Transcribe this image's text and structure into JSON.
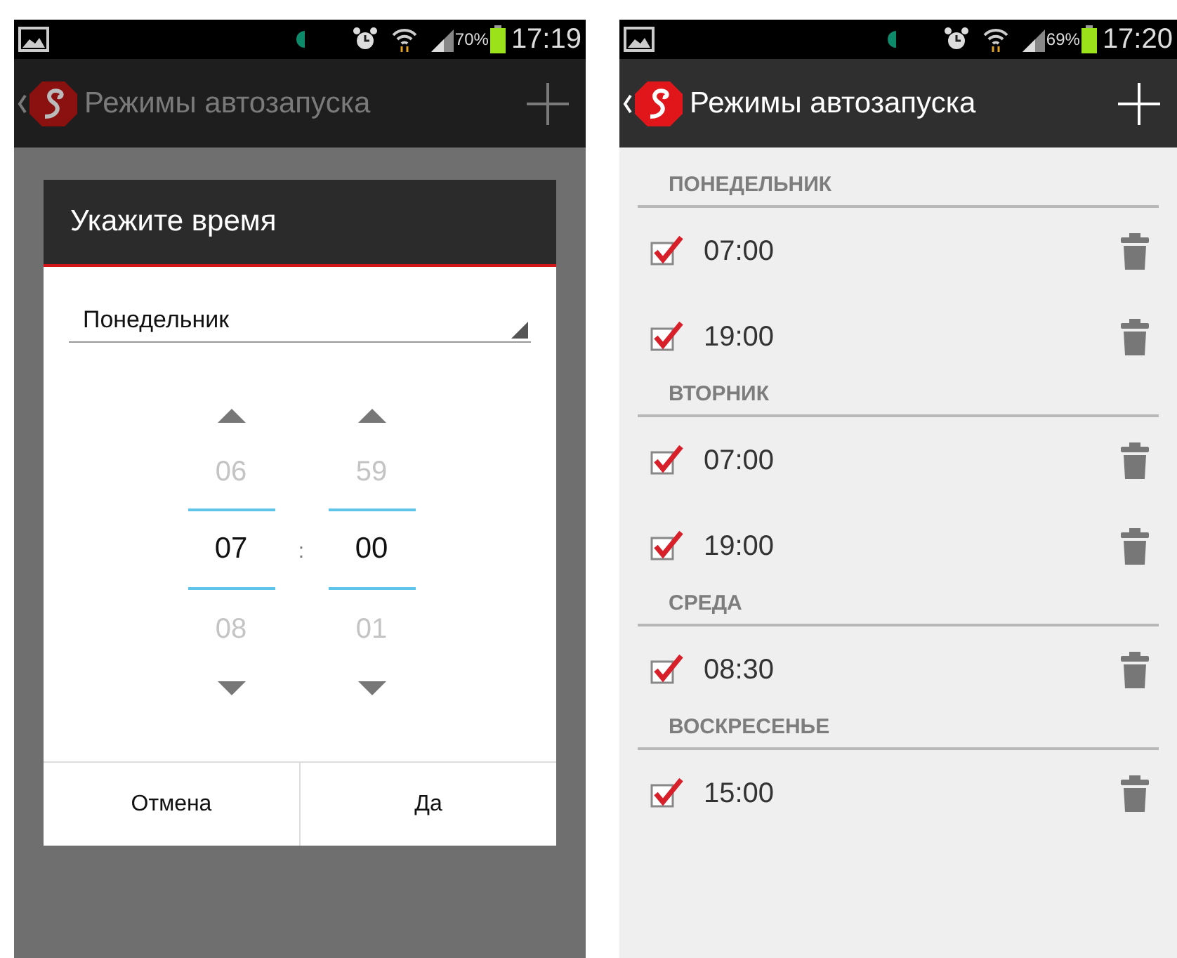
{
  "screens": [
    {
      "status_bar": {
        "battery": "70%",
        "time": "17:19"
      },
      "action_bar": {
        "title": "Режимы автозапуска"
      },
      "dialog": {
        "title": "Укажите время",
        "day_select": {
          "value": "Понедельник"
        },
        "pickers": [
          {
            "previous": "06",
            "current": "07",
            "next": "08"
          },
          {
            "previous": "59",
            "current": "00",
            "next": "01"
          }
        ],
        "separator": ":",
        "buttons": [
          "Отмена",
          "Да"
        ]
      }
    },
    {
      "status_bar": {
        "battery": "69%",
        "time": "17:20"
      },
      "action_bar": {
        "title": "Режимы автозапуска"
      },
      "sections": [
        {
          "day": "ПОНЕДЕЛЬНИК",
          "items": [
            {
              "time": "07:00",
              "checked": true
            },
            {
              "time": "19:00",
              "checked": true
            }
          ]
        },
        {
          "day": "ВТОРНИК",
          "items": [
            {
              "time": "07:00",
              "checked": true
            },
            {
              "time": "19:00",
              "checked": true
            }
          ]
        },
        {
          "day": "СРЕДА",
          "items": [
            {
              "time": "08:30",
              "checked": true
            }
          ]
        },
        {
          "day": "ВОСКРЕСЕНЬЕ",
          "items": [
            {
              "time": "15:00",
              "checked": true
            }
          ]
        }
      ]
    }
  ]
}
